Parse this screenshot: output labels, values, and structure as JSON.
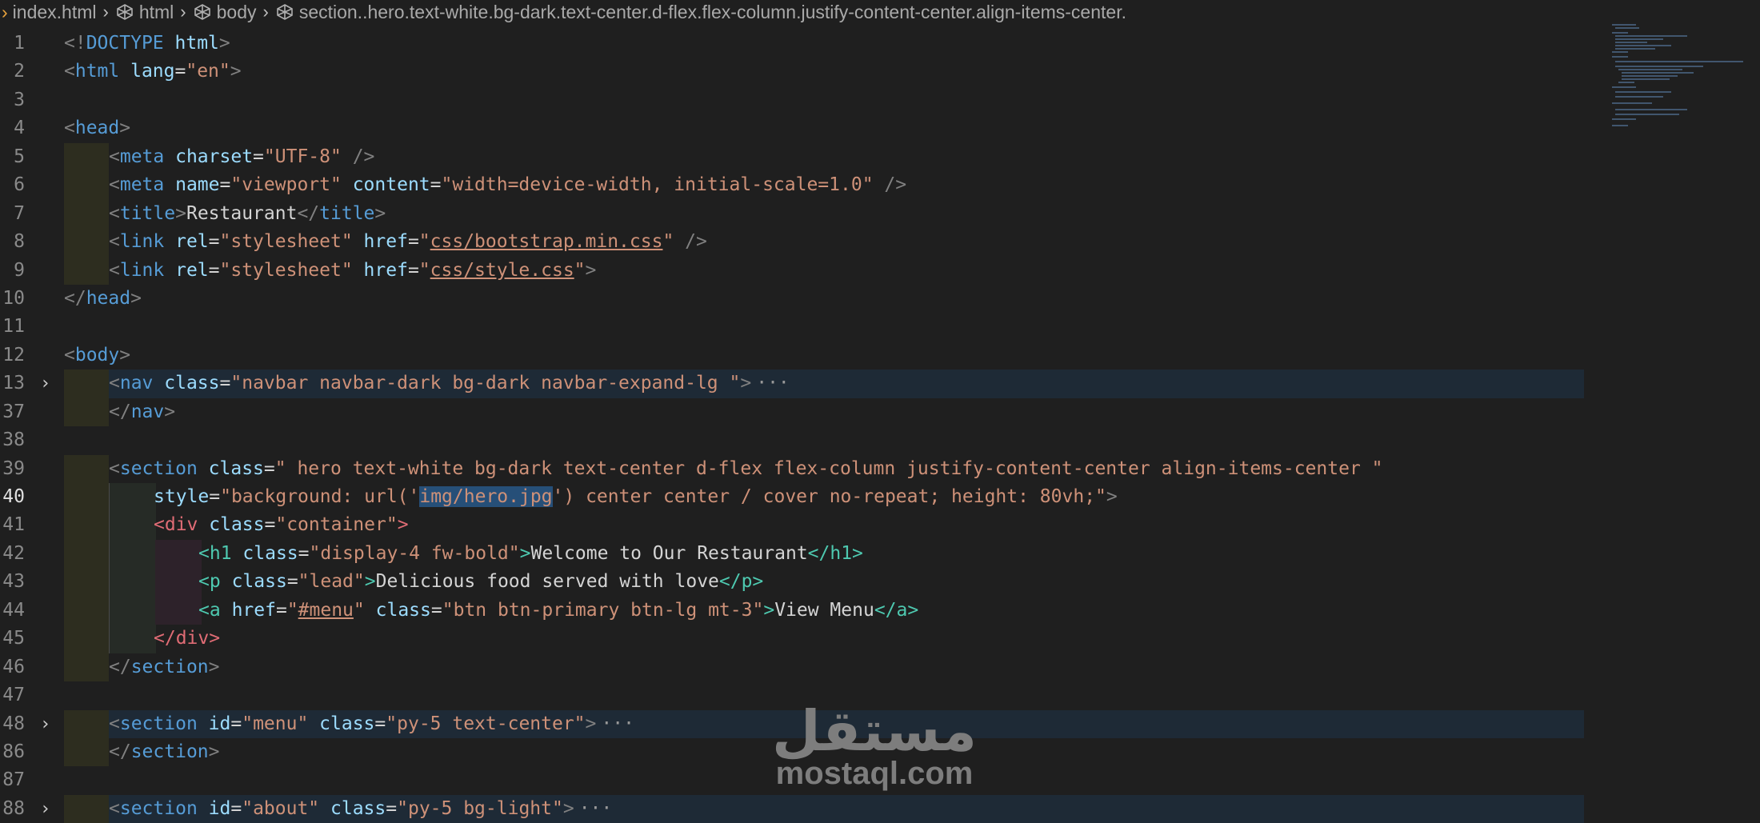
{
  "breadcrumb": {
    "file": "index.html",
    "items": [
      "html",
      "body",
      "section..hero.text-white.bg-dark.text-center.d-flex.flex-column.justify-content-center.align-items-center."
    ]
  },
  "lines": [
    {
      "n": "1",
      "tokens": [
        [
          "t-punc",
          "<!"
        ],
        [
          "t-tag",
          "DOCTYPE"
        ],
        [
          "t-text",
          " "
        ],
        [
          "t-attr",
          "html"
        ],
        [
          "t-punc",
          ">"
        ]
      ]
    },
    {
      "n": "2",
      "tokens": [
        [
          "t-punc",
          "<"
        ],
        [
          "t-tag",
          "html"
        ],
        [
          "t-text",
          " "
        ],
        [
          "t-attr",
          "lang"
        ],
        [
          "t-text",
          "="
        ],
        [
          "t-str",
          "\"en\""
        ],
        [
          "t-punc",
          ">"
        ]
      ]
    },
    {
      "n": "3",
      "tokens": []
    },
    {
      "n": "4",
      "tokens": [
        [
          "t-punc",
          "<"
        ],
        [
          "t-tag",
          "head"
        ],
        [
          "t-punc",
          ">"
        ]
      ]
    },
    {
      "n": "5",
      "guides": 1,
      "tokens": [
        [
          "t-punc",
          "<"
        ],
        [
          "t-tag",
          "meta"
        ],
        [
          "t-text",
          " "
        ],
        [
          "t-attr",
          "charset"
        ],
        [
          "t-text",
          "="
        ],
        [
          "t-str",
          "\"UTF-8\""
        ],
        [
          "t-text",
          " "
        ],
        [
          "t-punc",
          "/>"
        ]
      ]
    },
    {
      "n": "6",
      "guides": 1,
      "tokens": [
        [
          "t-punc",
          "<"
        ],
        [
          "t-tag",
          "meta"
        ],
        [
          "t-text",
          " "
        ],
        [
          "t-attr",
          "name"
        ],
        [
          "t-text",
          "="
        ],
        [
          "t-str",
          "\"viewport\""
        ],
        [
          "t-text",
          " "
        ],
        [
          "t-attr",
          "content"
        ],
        [
          "t-text",
          "="
        ],
        [
          "t-str",
          "\"width=device-width, initial-scale=1.0\""
        ],
        [
          "t-text",
          " "
        ],
        [
          "t-punc",
          "/>"
        ]
      ]
    },
    {
      "n": "7",
      "guides": 1,
      "tokens": [
        [
          "t-punc",
          "<"
        ],
        [
          "t-tag",
          "title"
        ],
        [
          "t-punc",
          ">"
        ],
        [
          "t-text",
          "Restaurant"
        ],
        [
          "t-punc",
          "</"
        ],
        [
          "t-tag",
          "title"
        ],
        [
          "t-punc",
          ">"
        ]
      ]
    },
    {
      "n": "8",
      "guides": 1,
      "tokens": [
        [
          "t-punc",
          "<"
        ],
        [
          "t-tag",
          "link"
        ],
        [
          "t-text",
          " "
        ],
        [
          "t-attr",
          "rel"
        ],
        [
          "t-text",
          "="
        ],
        [
          "t-str",
          "\"stylesheet\""
        ],
        [
          "t-text",
          " "
        ],
        [
          "t-attr",
          "href"
        ],
        [
          "t-text",
          "="
        ],
        [
          "t-str",
          "\""
        ],
        [
          "t-str t-link",
          "css/bootstrap.min.css"
        ],
        [
          "t-str",
          "\""
        ],
        [
          "t-text",
          " "
        ],
        [
          "t-punc",
          "/>"
        ]
      ]
    },
    {
      "n": "9",
      "guides": 1,
      "tokens": [
        [
          "t-punc",
          "<"
        ],
        [
          "t-tag",
          "link"
        ],
        [
          "t-text",
          " "
        ],
        [
          "t-attr",
          "rel"
        ],
        [
          "t-text",
          "="
        ],
        [
          "t-str",
          "\"stylesheet\""
        ],
        [
          "t-text",
          " "
        ],
        [
          "t-attr",
          "href"
        ],
        [
          "t-text",
          "="
        ],
        [
          "t-str",
          "\""
        ],
        [
          "t-str t-link",
          "css/style.css"
        ],
        [
          "t-str",
          "\""
        ],
        [
          "t-punc",
          ">"
        ]
      ]
    },
    {
      "n": "10",
      "tokens": [
        [
          "t-punc",
          "</"
        ],
        [
          "t-tag",
          "head"
        ],
        [
          "t-punc",
          ">"
        ]
      ]
    },
    {
      "n": "11",
      "tokens": []
    },
    {
      "n": "12",
      "tokens": [
        [
          "t-punc",
          "<"
        ],
        [
          "t-tag",
          "body"
        ],
        [
          "t-punc",
          ">"
        ]
      ]
    },
    {
      "n": "13",
      "fold": true,
      "hl": true,
      "guides": 1,
      "ellipsis": "···",
      "tokens": [
        [
          "t-punc",
          "<"
        ],
        [
          "t-tag",
          "nav"
        ],
        [
          "t-text",
          " "
        ],
        [
          "t-attr",
          "class"
        ],
        [
          "t-text",
          "="
        ],
        [
          "t-str",
          "\"navbar navbar-dark bg-dark navbar-expand-lg \""
        ],
        [
          "t-punc",
          ">"
        ]
      ]
    },
    {
      "n": "37",
      "guides": 1,
      "tokens": [
        [
          "t-punc",
          "</"
        ],
        [
          "t-tag",
          "nav"
        ],
        [
          "t-punc",
          ">"
        ]
      ]
    },
    {
      "n": "38",
      "tokens": []
    },
    {
      "n": "39",
      "guides": 1,
      "tokens": [
        [
          "t-punc",
          "<"
        ],
        [
          "t-tag",
          "section"
        ],
        [
          "t-text",
          " "
        ],
        [
          "t-attr",
          "class"
        ],
        [
          "t-text",
          "="
        ],
        [
          "t-str",
          "\" hero text-white bg-dark text-center d-flex flex-column justify-content-center align-items-center \""
        ]
      ]
    },
    {
      "n": "40",
      "active": true,
      "guides": 2,
      "tokens": [
        [
          "t-attr",
          "style"
        ],
        [
          "t-text",
          "="
        ],
        [
          "t-str",
          "\"background: url('"
        ],
        [
          "t-str t-sel",
          "img/hero.jpg"
        ],
        [
          "t-str",
          "') center center / cover no-repeat; height: 80vh;\""
        ],
        [
          "t-punc",
          ">"
        ]
      ]
    },
    {
      "n": "41",
      "guides": 2,
      "tokens": [
        [
          "t-div",
          "<div"
        ],
        [
          "t-text",
          " "
        ],
        [
          "t-attr",
          "class"
        ],
        [
          "t-text",
          "="
        ],
        [
          "t-str",
          "\"container\""
        ],
        [
          "t-div",
          ">"
        ]
      ]
    },
    {
      "n": "42",
      "guides": 3,
      "tokens": [
        [
          "t-green",
          "<h1"
        ],
        [
          "t-text",
          " "
        ],
        [
          "t-attr",
          "class"
        ],
        [
          "t-text",
          "="
        ],
        [
          "t-str",
          "\"display-4 fw-bold\""
        ],
        [
          "t-green",
          ">"
        ],
        [
          "t-text",
          "Welcome to Our Restaurant"
        ],
        [
          "t-green",
          "</h1>"
        ]
      ]
    },
    {
      "n": "43",
      "guides": 3,
      "tokens": [
        [
          "t-green",
          "<p"
        ],
        [
          "t-text",
          " "
        ],
        [
          "t-attr",
          "class"
        ],
        [
          "t-text",
          "="
        ],
        [
          "t-str",
          "\"lead\""
        ],
        [
          "t-green",
          ">"
        ],
        [
          "t-text",
          "Delicious food served with love"
        ],
        [
          "t-green",
          "</p>"
        ]
      ]
    },
    {
      "n": "44",
      "guides": 3,
      "tokens": [
        [
          "t-green",
          "<a"
        ],
        [
          "t-text",
          " "
        ],
        [
          "t-attr",
          "href"
        ],
        [
          "t-text",
          "="
        ],
        [
          "t-str",
          "\""
        ],
        [
          "t-str t-link",
          "#menu"
        ],
        [
          "t-str",
          "\""
        ],
        [
          "t-text",
          " "
        ],
        [
          "t-attr",
          "class"
        ],
        [
          "t-text",
          "="
        ],
        [
          "t-str",
          "\"btn btn-primary btn-lg mt-3\""
        ],
        [
          "t-green",
          ">"
        ],
        [
          "t-text",
          "View Menu"
        ],
        [
          "t-green",
          "</a>"
        ]
      ]
    },
    {
      "n": "45",
      "guides": 2,
      "tokens": [
        [
          "t-div",
          "</div>"
        ]
      ]
    },
    {
      "n": "46",
      "guides": 1,
      "tokens": [
        [
          "t-punc",
          "</"
        ],
        [
          "t-tag",
          "section"
        ],
        [
          "t-punc",
          ">"
        ]
      ]
    },
    {
      "n": "47",
      "tokens": []
    },
    {
      "n": "48",
      "fold": true,
      "hl": true,
      "guides": 1,
      "ellipsis": "···",
      "tokens": [
        [
          "t-punc",
          "<"
        ],
        [
          "t-tag",
          "section"
        ],
        [
          "t-text",
          " "
        ],
        [
          "t-attr",
          "id"
        ],
        [
          "t-text",
          "="
        ],
        [
          "t-str",
          "\"menu\""
        ],
        [
          "t-text",
          " "
        ],
        [
          "t-attr",
          "class"
        ],
        [
          "t-text",
          "="
        ],
        [
          "t-str",
          "\"py-5 text-center\""
        ],
        [
          "t-punc",
          ">"
        ]
      ]
    },
    {
      "n": "86",
      "guides": 1,
      "tokens": [
        [
          "t-punc",
          "</"
        ],
        [
          "t-tag",
          "section"
        ],
        [
          "t-punc",
          ">"
        ]
      ]
    },
    {
      "n": "87",
      "tokens": []
    },
    {
      "n": "88",
      "fold": true,
      "hl": true,
      "guides": 1,
      "ellipsis": "···",
      "tokens": [
        [
          "t-punc",
          "<"
        ],
        [
          "t-tag",
          "section"
        ],
        [
          "t-text",
          " "
        ],
        [
          "t-attr",
          "id"
        ],
        [
          "t-text",
          "="
        ],
        [
          "t-str",
          "\"about\""
        ],
        [
          "t-text",
          " "
        ],
        [
          "t-attr",
          "class"
        ],
        [
          "t-text",
          "="
        ],
        [
          "t-str",
          "\"py-5 bg-light\""
        ],
        [
          "t-punc",
          ">"
        ]
      ]
    }
  ],
  "fold_icon": "chevron-right-icon",
  "watermark": {
    "arabic": "مستقل",
    "latin": "mostaql.com"
  },
  "colors": {
    "background": "#1f1f1f",
    "tag": "#569cd6",
    "attr": "#9cdcfe",
    "string": "#ce9178",
    "selection": "#264f78"
  }
}
